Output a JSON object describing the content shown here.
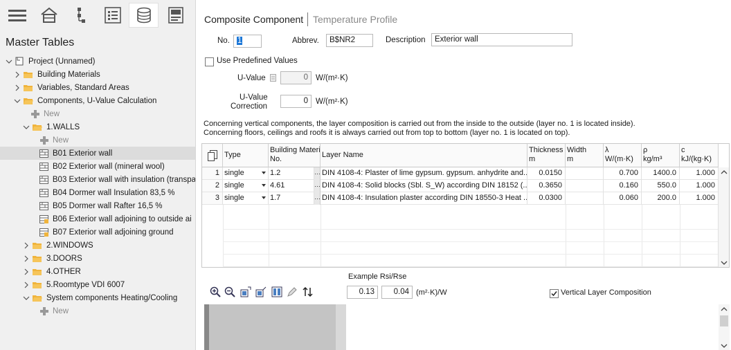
{
  "toolbar": {
    "icons": [
      "menu-icon",
      "building-icon",
      "hierarchy-icon",
      "list-icon",
      "database-icon",
      "form-icon"
    ]
  },
  "sidebar": {
    "title": "Master Tables",
    "tree": [
      {
        "label": "Project (Unnamed)"
      },
      {
        "label": "Building Materials"
      },
      {
        "label": "Variables, Standard Areas"
      },
      {
        "label": "Components, U-Value Calculation"
      },
      {
        "label": "New"
      },
      {
        "label": "1.WALLS"
      },
      {
        "label": "New"
      },
      {
        "label": "B01 Exterior wall"
      },
      {
        "label": "B02 Exterior wall (mineral wool)"
      },
      {
        "label": "B03 Exterior wall with insulation (transpa"
      },
      {
        "label": "B04 Dormer wall Insulation 83,5 %"
      },
      {
        "label": "B05 Dormer wall Rafter 16,5 %"
      },
      {
        "label": "B06 Exterior wall adjoining to outside ai"
      },
      {
        "label": "B07 Exterior wall adjoining ground"
      },
      {
        "label": "2.WINDOWS"
      },
      {
        "label": "3.DOORS"
      },
      {
        "label": "4.OTHER"
      },
      {
        "label": "5.Roomtype VDI 6007"
      },
      {
        "label": "System components Heating/Cooling"
      },
      {
        "label": "New"
      }
    ]
  },
  "tabs": {
    "active": "Composite Component",
    "inactive": "Temperature Profile"
  },
  "form": {
    "no_label": "No.",
    "no_value": "1",
    "abbrev_label": "Abbrev.",
    "abbrev_value": "B$NR2",
    "desc_label": "Description",
    "desc_value": "Exterior wall",
    "predef_label": "Use Predefined Values",
    "uvalue_label": "U-Value",
    "uvalue_value": "0",
    "uvalue_unit": "W/(m²·K)",
    "corr_label1": "U-Value",
    "corr_label2": "Correction",
    "corr_value": "0",
    "corr_unit": "W/(m²·K)",
    "note1": "Concerning vertical components, the layer composition is carried out from the inside to the outside (layer no. 1 is located inside).",
    "note2": "Concerning floors, ceilings and roofs it is always carried out from top to bottom (layer no. 1 is located on top)."
  },
  "grid": {
    "headers": {
      "type": "Type",
      "bm1": "Building Materia",
      "bm2": "No.",
      "layer": "Layer Name",
      "thick1": "Thickness",
      "thick2": "m",
      "width1": "Width",
      "width2": "m",
      "lambda1": "λ",
      "lambda2": "W/(m·K)",
      "rho1": "ρ",
      "rho2": "kg/m³",
      "c1": "c",
      "c2": "kJ/(kg·K)"
    },
    "rows": [
      {
        "no": "1",
        "type": "single",
        "bm": "1.2",
        "layer": "DIN 4108-4: Plaster of  lime gypsum.  gypsum.  anhydrite and...",
        "thickness": "0.0150",
        "width": "",
        "lambda": "0.700",
        "rho": "1400.0",
        "c": "1.000"
      },
      {
        "no": "2",
        "type": "single",
        "bm": "4.61",
        "layer": "DIN 4108-4: Solid blocks (Sbl. S_W) according DIN 18152 (...",
        "thickness": "0.3650",
        "width": "",
        "lambda": "0.160",
        "rho": "550.0",
        "c": "1.000"
      },
      {
        "no": "3",
        "type": "single",
        "bm": "1.7",
        "layer": "DIN 4108-4: Insulation plaster according DIN 18550-3 Heat ...",
        "thickness": "0.0300",
        "width": "",
        "lambda": "0.060",
        "rho": "200.0",
        "c": "1.000"
      }
    ]
  },
  "bottom": {
    "rsi_label": "Example Rsi/Rse",
    "rsi_value": "0.13",
    "rse_value": "0.04",
    "rsi_unit": "(m²·K)/W",
    "vertical_label": "Vertical Layer Composition",
    "tools": [
      "zoom-in-icon",
      "zoom-out-icon",
      "insert-layer-icon",
      "insert-layer-2-icon",
      "columns-icon",
      "edit-icon",
      "sort-icon"
    ]
  }
}
